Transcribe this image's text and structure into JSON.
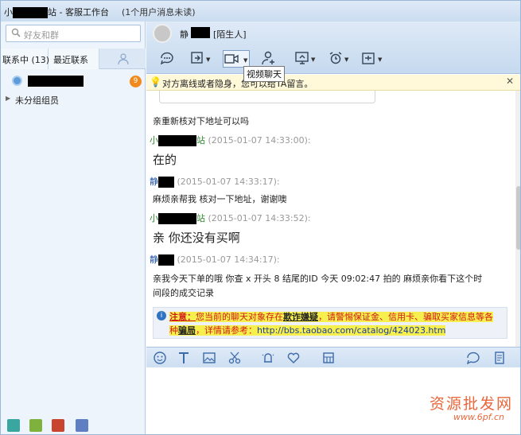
{
  "window": {
    "title_prefix": "小",
    "title_suffix": "站 - 客服工作台",
    "unread": "(1个用户消息未读)"
  },
  "left": {
    "search_placeholder": "好友和群",
    "tab_contacts": "联系中 (13)",
    "tab_recent": "最近联系",
    "contact_badge": "9",
    "group_label": "未分组组员"
  },
  "chat": {
    "name_prefix": "静",
    "stranger": "[陌生人]",
    "tooltip": "视频聊天",
    "notice": "对方离线或者隐身，您可以给TA留言。",
    "messages": [
      {
        "text": "亲重新核对下地址可以吗"
      },
      {
        "sender_prefix": "小",
        "sender_suffix": "站",
        "time": " (2015-01-07 14:33:00):",
        "text": "在的"
      },
      {
        "sender_prefix": "静",
        "time": " (2015-01-07 14:33:17):",
        "text": "麻烦亲帮我 核对一下地址，谢谢噢"
      },
      {
        "sender_prefix": "小",
        "sender_suffix": "站",
        "time": " (2015-01-07 14:33:52):",
        "text": "亲 你还没有买啊"
      },
      {
        "sender_prefix": "静",
        "time": " (2015-01-07 14:34:17):",
        "text1": "亲我今天下单的哦  你查 x 开头 8 结尾的ID  今天 09:02:47 拍的  麻烦亲你看下这个时",
        "text2": "间段的成交记录"
      }
    ],
    "warning": {
      "label": "注意：",
      "part1": "您当前的聊天对象存在",
      "keyword1": "欺诈嫌疑",
      "part2": "，请警惕保证金、信用卡、骗取买家信息等各",
      "part3": "种",
      "keyword2": "骗局",
      "part4": "，详情请参考：",
      "link": "http://bbs.taobao.com/catalog/424023.htm"
    }
  },
  "watermark": {
    "line1": "资源批发网",
    "line2": "www.6pf.cn"
  },
  "colors": {
    "accent": "#1d4fa6",
    "other_sender": "#2f8a2f",
    "warning_red": "#d11a1a",
    "badge": "#f08a1d"
  },
  "icons": [
    "search-icon",
    "add-contact-icon",
    "avatar-icon",
    "emoji-call-icon",
    "transfer-icon",
    "video-icon",
    "add-person-icon",
    "screen-share-icon",
    "alarm-icon",
    "apps-icon",
    "bulb-icon",
    "close-icon",
    "info-icon",
    "emoji-icon",
    "font-icon",
    "image-icon",
    "scissors-icon",
    "shake-icon",
    "heart-icon",
    "save-icon",
    "quick-reply-icon",
    "history-icon"
  ]
}
